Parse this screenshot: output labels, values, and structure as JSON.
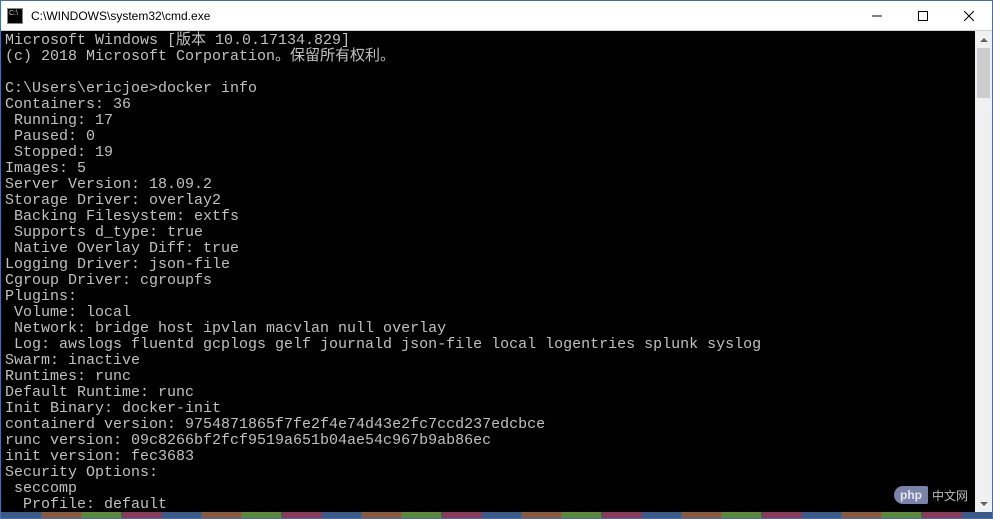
{
  "window": {
    "title": "C:\\WINDOWS\\system32\\cmd.exe"
  },
  "terminal": {
    "lines": [
      "Microsoft Windows [版本 10.0.17134.829]",
      "(c) 2018 Microsoft Corporation。保留所有权利。",
      "",
      "C:\\Users\\ericjoe>docker info",
      "Containers: 36",
      " Running: 17",
      " Paused: 0",
      " Stopped: 19",
      "Images: 5",
      "Server Version: 18.09.2",
      "Storage Driver: overlay2",
      " Backing Filesystem: extfs",
      " Supports d_type: true",
      " Native Overlay Diff: true",
      "Logging Driver: json-file",
      "Cgroup Driver: cgroupfs",
      "Plugins:",
      " Volume: local",
      " Network: bridge host ipvlan macvlan null overlay",
      " Log: awslogs fluentd gcplogs gelf journald json-file local logentries splunk syslog",
      "Swarm: inactive",
      "Runtimes: runc",
      "Default Runtime: runc",
      "Init Binary: docker-init",
      "containerd version: 9754871865f7fe2f4e74d43e2fc7ccd237edcbce",
      "runc version: 09c8266bf2fcf9519a651b04ae54c967b9ab86ec",
      "init version: fec3683",
      "Security Options:",
      " seccomp",
      "  Profile: default"
    ]
  },
  "watermark": {
    "badge": "php",
    "text": "中文网"
  }
}
